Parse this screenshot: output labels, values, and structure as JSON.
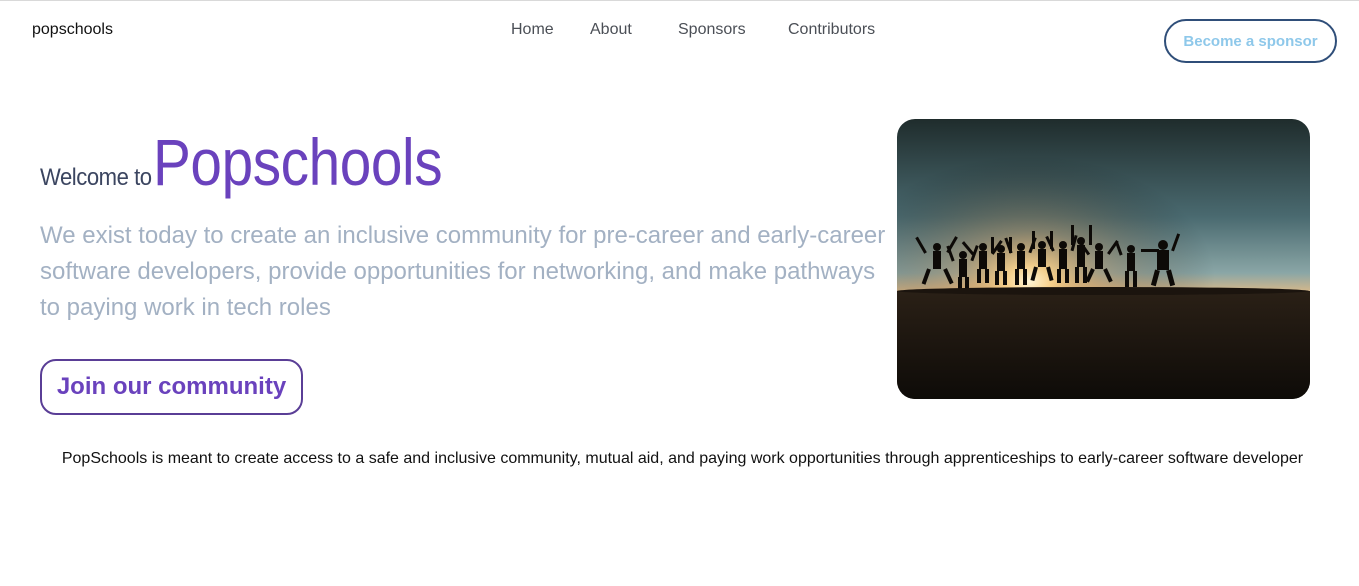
{
  "header": {
    "brand": "popschools",
    "nav": [
      "Home",
      "About",
      "Sponsors",
      "Contributors"
    ],
    "cta_label": "Become a sponsor"
  },
  "hero": {
    "welcome_prefix": "Welcome to",
    "welcome_name": "Popschools",
    "tagline": "We exist today to create an inclusive community for pre-career and early-career software developers, provide opportunities for networking, and make pathways to paying work in tech roles",
    "join_label": "Join our community",
    "image_icon": "silhouettes-jumping-sunset-photo"
  },
  "mission": "PopSchools is meant to create access to a safe and inclusive community, mutual aid, and paying work opportunities through apprenticeships to early-career software developer",
  "colors": {
    "accent": "#6a42bd",
    "cta_border": "#2f4e79",
    "cta_text": "#8ec8ea",
    "tagline": "#a3b1c3"
  }
}
